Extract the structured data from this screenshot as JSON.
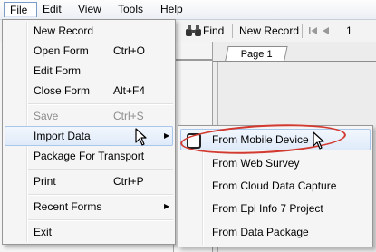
{
  "menubar": {
    "items": [
      {
        "label": "File",
        "active": true
      },
      {
        "label": "Edit"
      },
      {
        "label": "View"
      },
      {
        "label": "Tools"
      },
      {
        "label": "Help"
      }
    ]
  },
  "toolbar": {
    "find_icon": "binoculars-icon",
    "find_label": "Find",
    "new_record_label": "New Record",
    "first_record_icon": "first-record-icon",
    "prev_record_icon": "previous-record-icon",
    "record_number": "1"
  },
  "tab": {
    "label": "Page 1"
  },
  "file_menu": {
    "items": [
      {
        "label": "New Record",
        "shortcut": ""
      },
      {
        "label": "Open Form",
        "shortcut": "Ctrl+O"
      },
      {
        "label": "Edit Form",
        "shortcut": ""
      },
      {
        "label": "Close Form",
        "shortcut": "Alt+F4"
      },
      {
        "label": "Save",
        "shortcut": "Ctrl+S",
        "disabled": true
      },
      {
        "label": "Import Data",
        "shortcut": "",
        "submenu": true,
        "highlighted": true
      },
      {
        "label": "Package For Transport",
        "shortcut": ""
      },
      {
        "label": "Print",
        "shortcut": "Ctrl+P"
      },
      {
        "label": "Recent Forms",
        "shortcut": "",
        "submenu": true
      },
      {
        "label": "Exit",
        "shortcut": ""
      }
    ]
  },
  "import_submenu": {
    "items": [
      {
        "label": "From Mobile Device",
        "icon": "mobile-device-icon",
        "highlighted": true
      },
      {
        "label": "From Web Survey"
      },
      {
        "label": "From Cloud Data Capture"
      },
      {
        "label": "From Epi Info 7 Project"
      },
      {
        "label": "From Data Package"
      }
    ]
  },
  "colors": {
    "highlight_border": "#a9c6ec",
    "callout": "#d2392f"
  }
}
